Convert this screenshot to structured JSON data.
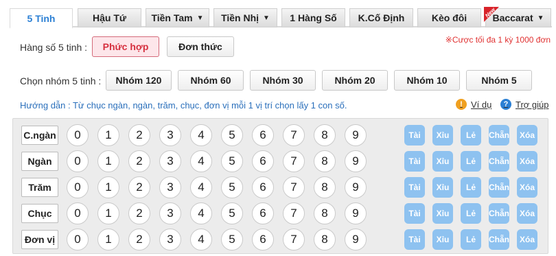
{
  "tabs": [
    {
      "label": "5 Tinh",
      "active": true,
      "dropdown": false
    },
    {
      "label": "Hậu Tứ",
      "active": false,
      "dropdown": false
    },
    {
      "label": "Tiền Tam",
      "active": false,
      "dropdown": true
    },
    {
      "label": "Tiền Nhị",
      "active": false,
      "dropdown": true
    },
    {
      "label": "1 Hàng Số",
      "active": false,
      "dropdown": false
    },
    {
      "label": "K.Cố Định",
      "active": false,
      "dropdown": false
    },
    {
      "label": "Kèo đôi",
      "active": false,
      "dropdown": false
    },
    {
      "label": "Baccarat",
      "active": false,
      "dropdown": true,
      "badge": "New"
    }
  ],
  "mode": {
    "label": "Hàng số 5 tinh :",
    "options": [
      {
        "label": "Phức hợp",
        "active": true
      },
      {
        "label": "Đơn thức",
        "active": false
      }
    ],
    "limit_note": "※Cược tối đa 1 kỳ 1000 đơn"
  },
  "groups": {
    "label": "Chọn nhóm 5 tinh :",
    "options": [
      "Nhóm 120",
      "Nhóm 60",
      "Nhóm 30",
      "Nhóm 20",
      "Nhóm 10",
      "Nhóm 5"
    ]
  },
  "guide": {
    "text": "Hướng dẫn : Từ chục ngàn, ngàn, trăm, chục, đơn vị mỗi 1 vị trí chọn lấy 1 con số.",
    "example_link": "Ví dụ",
    "help_link": "Trợ giúp"
  },
  "rows": [
    "C.ngàn",
    "Ngàn",
    "Trăm",
    "Chục",
    "Đơn vị"
  ],
  "digits": [
    "0",
    "1",
    "2",
    "3",
    "4",
    "5",
    "6",
    "7",
    "8",
    "9"
  ],
  "quick_buttons": [
    "Tài",
    "Xỉu",
    "Lẻ",
    "Chẵn",
    "Xóa"
  ],
  "colors": {
    "accent": "#2a7fd4",
    "active_bg": "#fde6ea",
    "active_text": "#d6303f",
    "quick_button": "#8ec2f0",
    "limit_text": "#e03030"
  }
}
